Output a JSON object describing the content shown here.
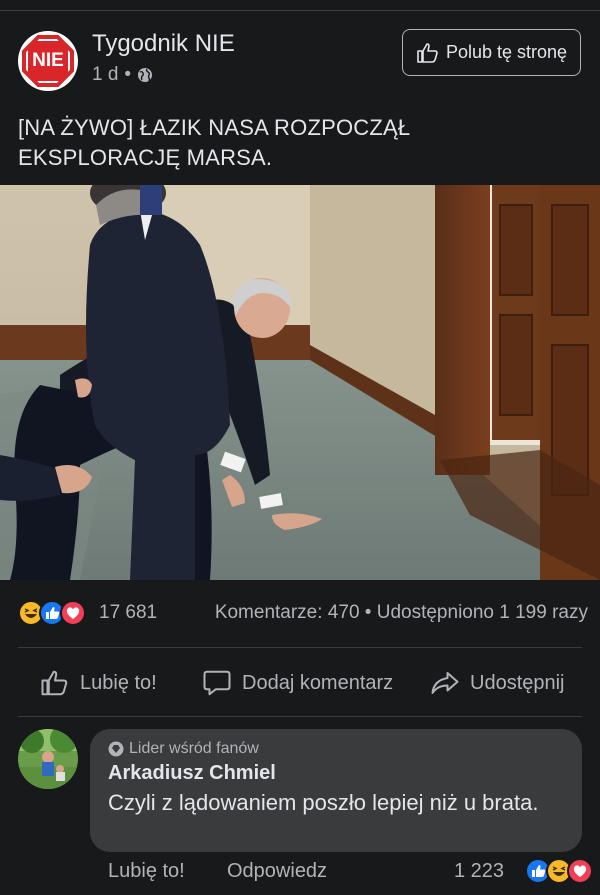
{
  "page": {
    "name": "Tygodnik NIE",
    "logo_text": "NIE",
    "time": "1 d",
    "dot": "•",
    "like_page_label": "Polub tę stronę"
  },
  "post": {
    "text": "[NA ŻYWO] ŁAZIK NASA ROZPOCZĄŁ EKSPLORACJĘ MARSA.",
    "image_icon": "photo-politicians-on-carpet"
  },
  "stats": {
    "reactions_count": "17 681",
    "comments": "Komentarze: 470",
    "separator": "•",
    "shares": "Udostępniono 1 199 razy",
    "reaction_icons": [
      "haha-icon",
      "like-icon",
      "love-icon"
    ]
  },
  "actions": {
    "like": "Lubię to!",
    "comment": "Dodaj komentarz",
    "share": "Udostępnij"
  },
  "comment": {
    "badge": "Lider wśród fanów",
    "author": "Arkadiusz Chmiel",
    "text": "Czyli z lądowaniem poszło lepiej niż u brata.",
    "like_label": "Lubię to!",
    "reply_label": "Odpowiedz",
    "reaction_count": "1 223",
    "reaction_icons": [
      "like-icon",
      "haha-icon",
      "love-icon"
    ]
  },
  "colors": {
    "background": "#18191a",
    "bubble": "#3a3b3c",
    "text": "#e4e6eb",
    "secondary_text": "#b0b3b8",
    "like_blue": "#1877f2",
    "love_red": "#f33e58",
    "haha_yellow": "#f7b928",
    "logo_red": "#d8262a"
  }
}
